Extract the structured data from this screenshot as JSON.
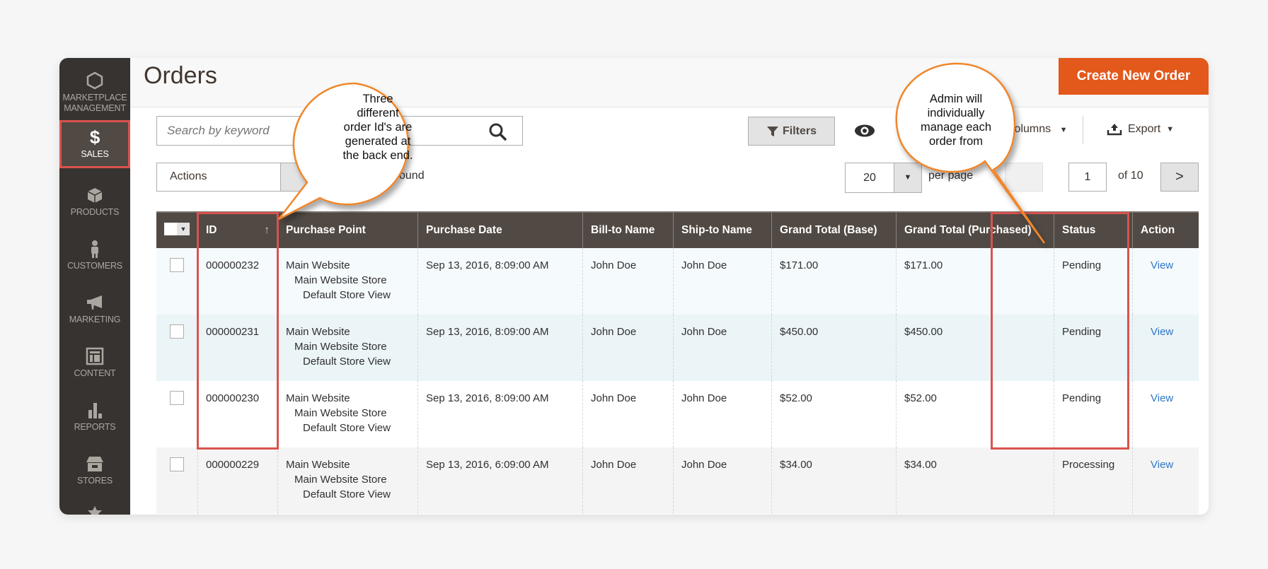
{
  "sidebar": {
    "items": [
      {
        "label": "MARKETPLACE MANAGEMENT",
        "icon": "hexagon-icon"
      },
      {
        "label": "SALES",
        "icon": "dollar-icon",
        "active": true
      },
      {
        "label": "PRODUCTS",
        "icon": "box-icon"
      },
      {
        "label": "CUSTOMERS",
        "icon": "person-icon"
      },
      {
        "label": "MARKETING",
        "icon": "megaphone-icon"
      },
      {
        "label": "CONTENT",
        "icon": "layout-icon"
      },
      {
        "label": "REPORTS",
        "icon": "bar-chart-icon"
      },
      {
        "label": "STORES",
        "icon": "storefront-icon"
      }
    ]
  },
  "header": {
    "title": "Orders",
    "create_button": "Create New Order"
  },
  "toolbar": {
    "search_placeholder": "Search by keyword",
    "filters_label": "Filters",
    "columns_label": "Columns",
    "export_label": "Export",
    "actions_label": "Actions",
    "records_found": "ound",
    "per_page_value": "20",
    "per_page_label": "per page",
    "current_page": "1",
    "total_pages_label": "of 10",
    "next_label": ">"
  },
  "table": {
    "columns": [
      "ID",
      "Purchase Point",
      "Purchase Date",
      "Bill-to Name",
      "Ship-to Name",
      "Grand Total (Base)",
      "Grand Total (Purchased)",
      "Status",
      "Action"
    ],
    "sort_indicator": "↑",
    "rows": [
      {
        "id": "000000232",
        "pp1": "Main Website",
        "pp2": "Main Website Store",
        "pp3": "Default Store View",
        "date": "Sep 13, 2016, 8:09:00 AM",
        "bill": "John Doe",
        "ship": "John Doe",
        "base": "$171.00",
        "purchased": "$171.00",
        "status": "Pending",
        "action": "View"
      },
      {
        "id": "000000231",
        "pp1": "Main Website",
        "pp2": "Main Website Store",
        "pp3": "Default Store View",
        "date": "Sep 13, 2016, 8:09:00 AM",
        "bill": "John Doe",
        "ship": "John Doe",
        "base": "$450.00",
        "purchased": "$450.00",
        "status": "Pending",
        "action": "View"
      },
      {
        "id": "000000230",
        "pp1": "Main Website",
        "pp2": "Main Website Store",
        "pp3": "Default Store View",
        "date": "Sep 13, 2016, 8:09:00 AM",
        "bill": "John Doe",
        "ship": "John Doe",
        "base": "$52.00",
        "purchased": "$52.00",
        "status": "Pending",
        "action": "View"
      },
      {
        "id": "000000229",
        "pp1": "Main Website",
        "pp2": "Main Website Store",
        "pp3": "Default Store View",
        "date": "Sep 13, 2016, 6:09:00 AM",
        "bill": "John Doe",
        "ship": "John Doe",
        "base": "$34.00",
        "purchased": "$34.00",
        "status": "Processing",
        "action": "View"
      }
    ]
  },
  "callouts": {
    "left": "Three different order Id's are generated at the back end.",
    "left_lines": [
      "Three",
      "different",
      "order Id's are",
      "generated at",
      "the back end."
    ],
    "right_lines": [
      "Admin will",
      "individually",
      "manage each",
      "order from"
    ]
  },
  "colors": {
    "accent": "#e3581b",
    "sidebar_bg": "#373330",
    "header_bg": "#514943",
    "highlight": "#d9534f",
    "callout_border": "#f0862a",
    "link": "#2e78c7"
  }
}
